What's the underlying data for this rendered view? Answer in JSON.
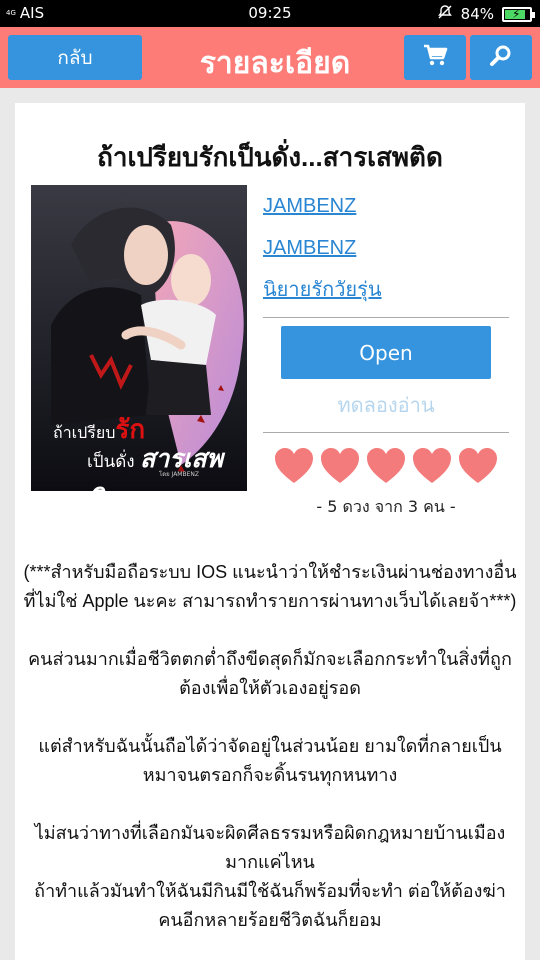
{
  "status": {
    "signal": "4G",
    "carrier": "AIS",
    "time": "09:25",
    "battery": "84%",
    "battery_level": 0.84
  },
  "header": {
    "back_label": "กลับ",
    "title": "รายละเอียด",
    "cart_icon": "cart-icon",
    "search_icon": "search-icon",
    "color": "#fd7c78",
    "button_color": "#3594dd"
  },
  "book": {
    "title": "ถ้าเปรียบรักเป็นดั่ง...สารเสพติด",
    "cover": {
      "line1": "ถ้าเปรียบ",
      "rak": "รัก",
      "line2": "เป็นดั่ง",
      "sarn": "สารเสพติด",
      "by": "โดย JAMBENZ"
    },
    "author": "JAMBENZ",
    "publisher": "JAMBENZ",
    "category": "นิยายรักวัยรุ่น",
    "open_label": "Open",
    "trial_label": "ทดลองอ่าน",
    "rating_stars": 5,
    "rating_text": "- 5 ดวง จาก 3 คน -"
  },
  "description": [
    "(***สำหรับมือถือระบบ IOS แนะนำว่าให้ชำระเงินผ่านช่องทางอื่นที่ไม่ใช่ Apple นะคะ สามารถทำรายการผ่านทางเว็บได้เลยจ้า***)",
    "คนส่วนมากเมื่อชีวิตตกต่ำถึงขีดสุดก็มักจะเลือกกระทำในสิ่งที่ถูกต้องเพื่อให้ตัวเองอยู่รอด",
    "แต่สำหรับฉันนั้นถือได้ว่าจัดอยู่ในส่วนน้อย ยามใดที่กลายเป็นหมาจนตรอกก็จะดิ้นรนทุกหนทาง",
    "ไม่สนว่าทางที่เลือกมันจะผิดศีลธรรมหรือผิดกฎหมายบ้านเมืองมากแค่ไหน",
    "ถ้าทำแล้วมันทำให้ฉันมีกินมีใช้ฉันก็พร้อมที่จะทำ ต่อให้ต้องฆ่าคนอีกหลายร้อยชีวิตฉันก็ยอม"
  ]
}
